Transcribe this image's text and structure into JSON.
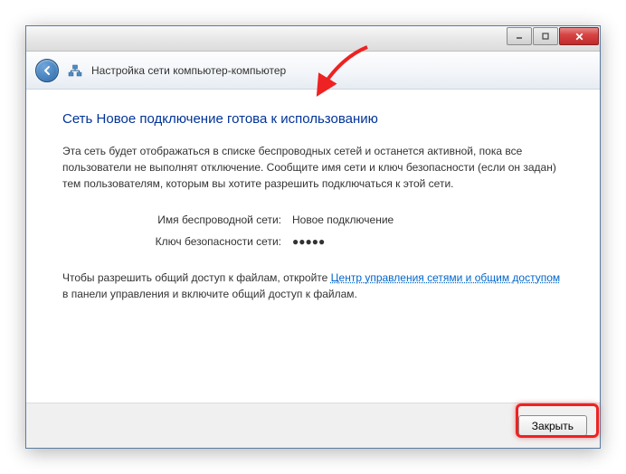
{
  "window": {
    "header_title": "Настройка сети компьютер-компьютер"
  },
  "content": {
    "heading": "Сеть Новое подключение готова к использованию",
    "description": "Эта сеть будет отображаться в списке беспроводных сетей и останется активной, пока все пользователи не выполнят отключение. Сообщите имя сети и ключ безопасности (если он задан) тем пользователям, которым вы хотите разрешить подключаться к этой сети.",
    "details": {
      "network_name_label": "Имя беспроводной сети:",
      "network_name_value": "Новое подключение",
      "security_key_label": "Ключ безопасности сети:",
      "security_key_value": "●●●●●"
    },
    "footer_text_before": "Чтобы разрешить общий доступ к файлам, откройте ",
    "footer_link": "Центр управления сетями и общим доступом",
    "footer_text_after": " в панели управления и включите общий доступ к файлам."
  },
  "buttons": {
    "close": "Закрыть"
  }
}
